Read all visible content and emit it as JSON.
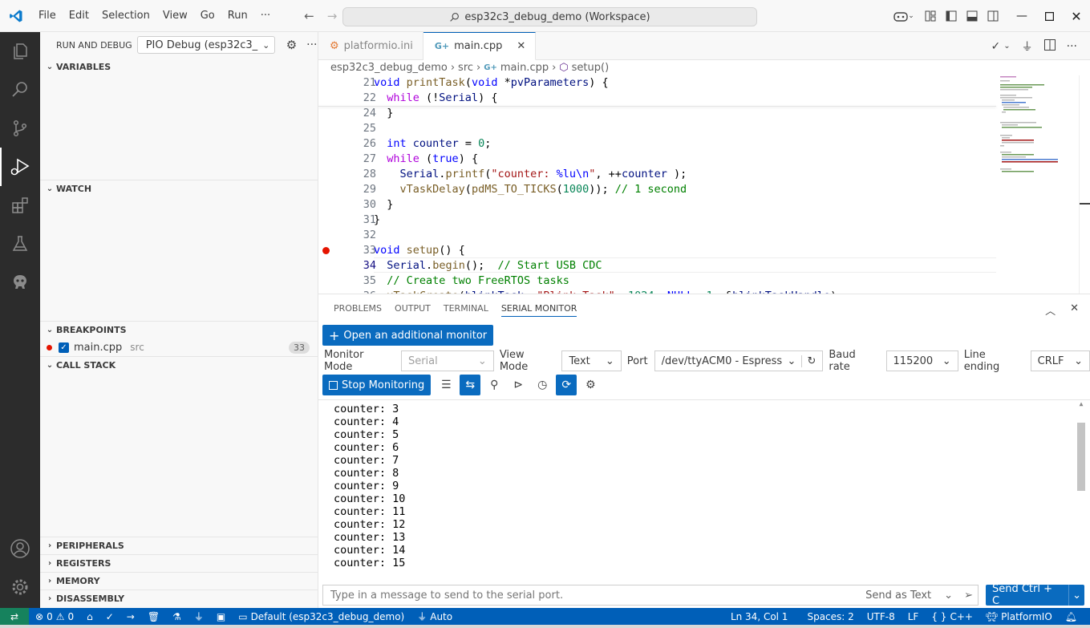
{
  "titlebar": {
    "menu": [
      "File",
      "Edit",
      "Selection",
      "View",
      "Go",
      "Run",
      "···"
    ],
    "search_text": "esp32c3_debug_demo (Workspace)"
  },
  "sidebar": {
    "run_debug_label": "RUN AND DEBUG",
    "debug_config": "PIO Debug (esp32c3_",
    "sections": {
      "variables": "VARIABLES",
      "watch": "WATCH",
      "breakpoints": "BREAKPOINTS",
      "call_stack": "CALL STACK",
      "peripherals": "PERIPHERALS",
      "registers": "REGISTERS",
      "memory": "MEMORY",
      "disassembly": "DISASSEMBLY"
    },
    "breakpoint_item": {
      "file": "main.cpp",
      "folder": "src",
      "line": "33"
    }
  },
  "editor": {
    "tabs": [
      {
        "label": "platformio.ini",
        "active": false
      },
      {
        "label": "main.cpp",
        "active": true
      }
    ],
    "breadcrumbs": [
      "esp32c3_debug_demo",
      "src",
      "main.cpp",
      "setup()"
    ],
    "lines": [
      {
        "n": "21",
        "tokens": [
          [
            "kw",
            "void"
          ],
          [
            "plain",
            " "
          ],
          [
            "fn",
            "printTask"
          ],
          [
            "plain",
            "("
          ],
          [
            "kw",
            "void"
          ],
          [
            "plain",
            " *"
          ],
          [
            "var",
            "pvParameters"
          ],
          [
            "plain",
            ") {"
          ]
        ]
      },
      {
        "n": "22",
        "tokens": [
          [
            "plain",
            "  "
          ],
          [
            "ctl",
            "while"
          ],
          [
            "plain",
            " (!"
          ],
          [
            "var",
            "Serial"
          ],
          [
            "plain",
            ") {"
          ]
        ]
      },
      {
        "n": "24",
        "tokens": [
          [
            "plain",
            "  }"
          ]
        ]
      },
      {
        "n": "25",
        "tokens": []
      },
      {
        "n": "26",
        "tokens": [
          [
            "plain",
            "  "
          ],
          [
            "kw",
            "int"
          ],
          [
            "plain",
            " "
          ],
          [
            "var",
            "counter"
          ],
          [
            "plain",
            " = "
          ],
          [
            "num",
            "0"
          ],
          [
            "plain",
            ";"
          ]
        ]
      },
      {
        "n": "27",
        "tokens": [
          [
            "plain",
            "  "
          ],
          [
            "ctl",
            "while"
          ],
          [
            "plain",
            " ("
          ],
          [
            "kw",
            "true"
          ],
          [
            "plain",
            ") {"
          ]
        ]
      },
      {
        "n": "28",
        "tokens": [
          [
            "plain",
            "    "
          ],
          [
            "var",
            "Serial"
          ],
          [
            "plain",
            "."
          ],
          [
            "fn",
            "printf"
          ],
          [
            "plain",
            "("
          ],
          [
            "str",
            "\"counter: "
          ],
          [
            "kw",
            "%lu\\n"
          ],
          [
            "str",
            "\""
          ],
          [
            "plain",
            ", ++"
          ],
          [
            "var",
            "counter"
          ],
          [
            "plain",
            " );"
          ]
        ]
      },
      {
        "n": "29",
        "tokens": [
          [
            "plain",
            "    "
          ],
          [
            "fn",
            "vTaskDelay"
          ],
          [
            "plain",
            "("
          ],
          [
            "fn",
            "pdMS_TO_TICKS"
          ],
          [
            "plain",
            "("
          ],
          [
            "num",
            "1000"
          ],
          [
            "plain",
            "));"
          ],
          [
            "cmt",
            " // 1 second"
          ]
        ]
      },
      {
        "n": "30",
        "tokens": [
          [
            "plain",
            "  }"
          ]
        ]
      },
      {
        "n": "31",
        "tokens": [
          [
            "plain",
            "}"
          ]
        ]
      },
      {
        "n": "32",
        "tokens": []
      },
      {
        "n": "33",
        "bp": true,
        "tokens": [
          [
            "kw",
            "void"
          ],
          [
            "plain",
            " "
          ],
          [
            "fn",
            "setup"
          ],
          [
            "plain",
            "() {"
          ]
        ]
      },
      {
        "n": "34",
        "current": true,
        "tokens": [
          [
            "plain",
            "  "
          ],
          [
            "var",
            "Serial"
          ],
          [
            "plain",
            "."
          ],
          [
            "fn",
            "begin"
          ],
          [
            "plain",
            "();  "
          ],
          [
            "cmt",
            "// Start USB CDC"
          ]
        ]
      },
      {
        "n": "35",
        "tokens": [
          [
            "plain",
            "  "
          ],
          [
            "cmt",
            "// Create two FreeRTOS tasks"
          ]
        ]
      },
      {
        "n": "36",
        "tokens": [
          [
            "plain",
            "  "
          ],
          [
            "fn",
            "xTaskCreate"
          ],
          [
            "plain",
            "("
          ],
          [
            "var",
            "blinkTask"
          ],
          [
            "plain",
            ", "
          ],
          [
            "str",
            "\"Blink Task\""
          ],
          [
            "plain",
            ", "
          ],
          [
            "num",
            "1024"
          ],
          [
            "plain",
            ", "
          ],
          [
            "kw",
            "NULL"
          ],
          [
            "plain",
            ", "
          ],
          [
            "num",
            "1"
          ],
          [
            "plain",
            ", &"
          ],
          [
            "var",
            "blinkTaskHandle"
          ],
          [
            "plain",
            ");"
          ]
        ]
      }
    ]
  },
  "panel": {
    "tabs": [
      "PROBLEMS",
      "OUTPUT",
      "TERMINAL",
      "SERIAL MONITOR"
    ],
    "active_tab": "SERIAL MONITOR",
    "open_monitor_label": "Open an additional monitor",
    "monitor_mode_label": "Monitor Mode",
    "monitor_mode_value": "Serial",
    "view_mode_label": "View Mode",
    "view_mode_value": "Text",
    "port_label": "Port",
    "port_value": "/dev/ttyACM0 - Espressif",
    "baud_label": "Baud rate",
    "baud_value": "115200",
    "line_ending_label": "Line ending",
    "line_ending_value": "CRLF",
    "stop_label": "Stop Monitoring",
    "output_lines": [
      "counter: 3",
      "counter: 4",
      "counter: 5",
      "counter: 6",
      "counter: 7",
      "counter: 8",
      "counter: 9",
      "counter: 10",
      "counter: 11",
      "counter: 12",
      "counter: 13",
      "counter: 14",
      "counter: 15"
    ],
    "send_placeholder": "Type in a message to send to the serial port.",
    "send_mode": "Send as Text",
    "send_button": "Send Ctrl + C"
  },
  "statusbar": {
    "errors": "0",
    "warnings": "0",
    "env": "Default (esp32c3_debug_demo)",
    "auto": "Auto",
    "position": "Ln 34, Col 1",
    "spaces": "Spaces: 2",
    "encoding": "UTF-8",
    "eol": "LF",
    "language": "C++",
    "platformio": "PlatformIO"
  },
  "colors": {
    "accent": "#005fb8",
    "button": "#0a6bbf",
    "activity_bar": "#2c2c2c",
    "breakpoint": "#e51400"
  }
}
